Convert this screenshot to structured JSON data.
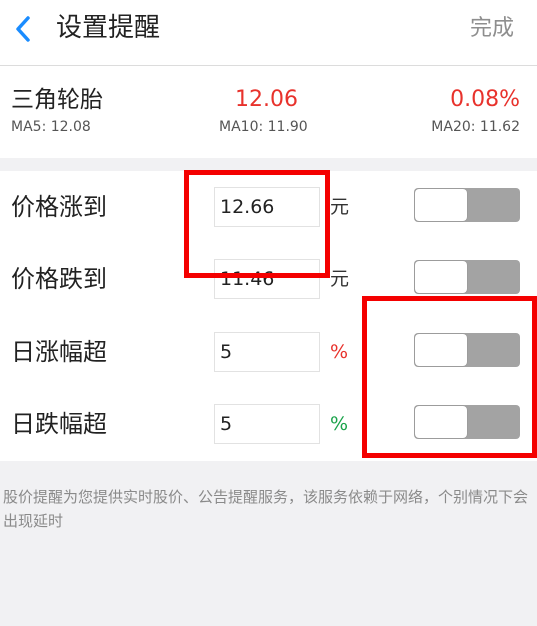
{
  "header": {
    "title": "设置提醒",
    "done_label": "完成"
  },
  "stock": {
    "name": "三角轮胎",
    "price": "12.06",
    "change_percent": "0.08%",
    "ma5": "MA5: 12.08",
    "ma10": "MA10: 11.90",
    "ma20": "MA20: 11.62",
    "price_color": "#e8322c"
  },
  "alerts": [
    {
      "label": "价格涨到",
      "value": "12.66",
      "unit": "元",
      "unit_color": "#333333",
      "enabled": false
    },
    {
      "label": "价格跌到",
      "value": "11.46",
      "unit": "元",
      "unit_color": "#333333",
      "enabled": false
    },
    {
      "label": "日涨幅超",
      "value": "5",
      "unit": "%",
      "unit_color": "#e8322c",
      "enabled": false
    },
    {
      "label": "日跌幅超",
      "value": "5",
      "unit": "%",
      "unit_color": "#1aa34a",
      "enabled": false
    }
  ],
  "notice": "股价提醒为您提供实时股价、公告提醒服务，该服务依赖于网络，个别情况下会出现延时",
  "colors": {
    "accent": "#1a8cff",
    "highlight": "#f40000",
    "toggle_off": "#a3a3a3"
  },
  "icons": {
    "back": "chevron-left-icon"
  }
}
